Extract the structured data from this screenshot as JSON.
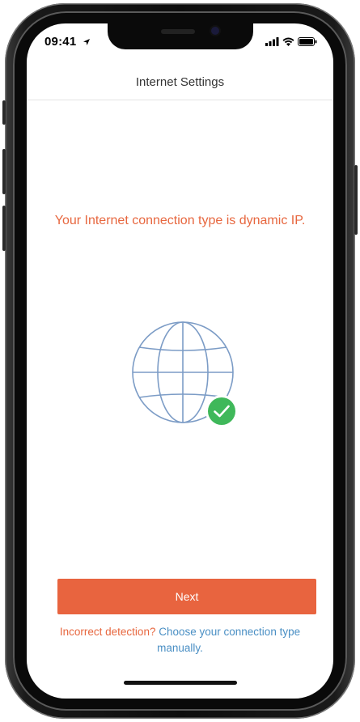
{
  "status_bar": {
    "time": "09:41",
    "icons": [
      "location-arrow-icon",
      "signal-bars-icon",
      "wifi-icon",
      "battery-icon"
    ]
  },
  "nav": {
    "title": "Internet Settings"
  },
  "main": {
    "headline": "Your Internet connection type is dynamic IP.",
    "illustration": "globe-with-check-icon",
    "next_label": "Next",
    "footer_prefix": "Incorrect detection?",
    "footer_link": "Choose your connection type manually."
  },
  "colors": {
    "accent": "#e8643f",
    "link": "#4a8fc4",
    "globe_stroke": "#7c9cc6",
    "success": "#3fb85a"
  }
}
